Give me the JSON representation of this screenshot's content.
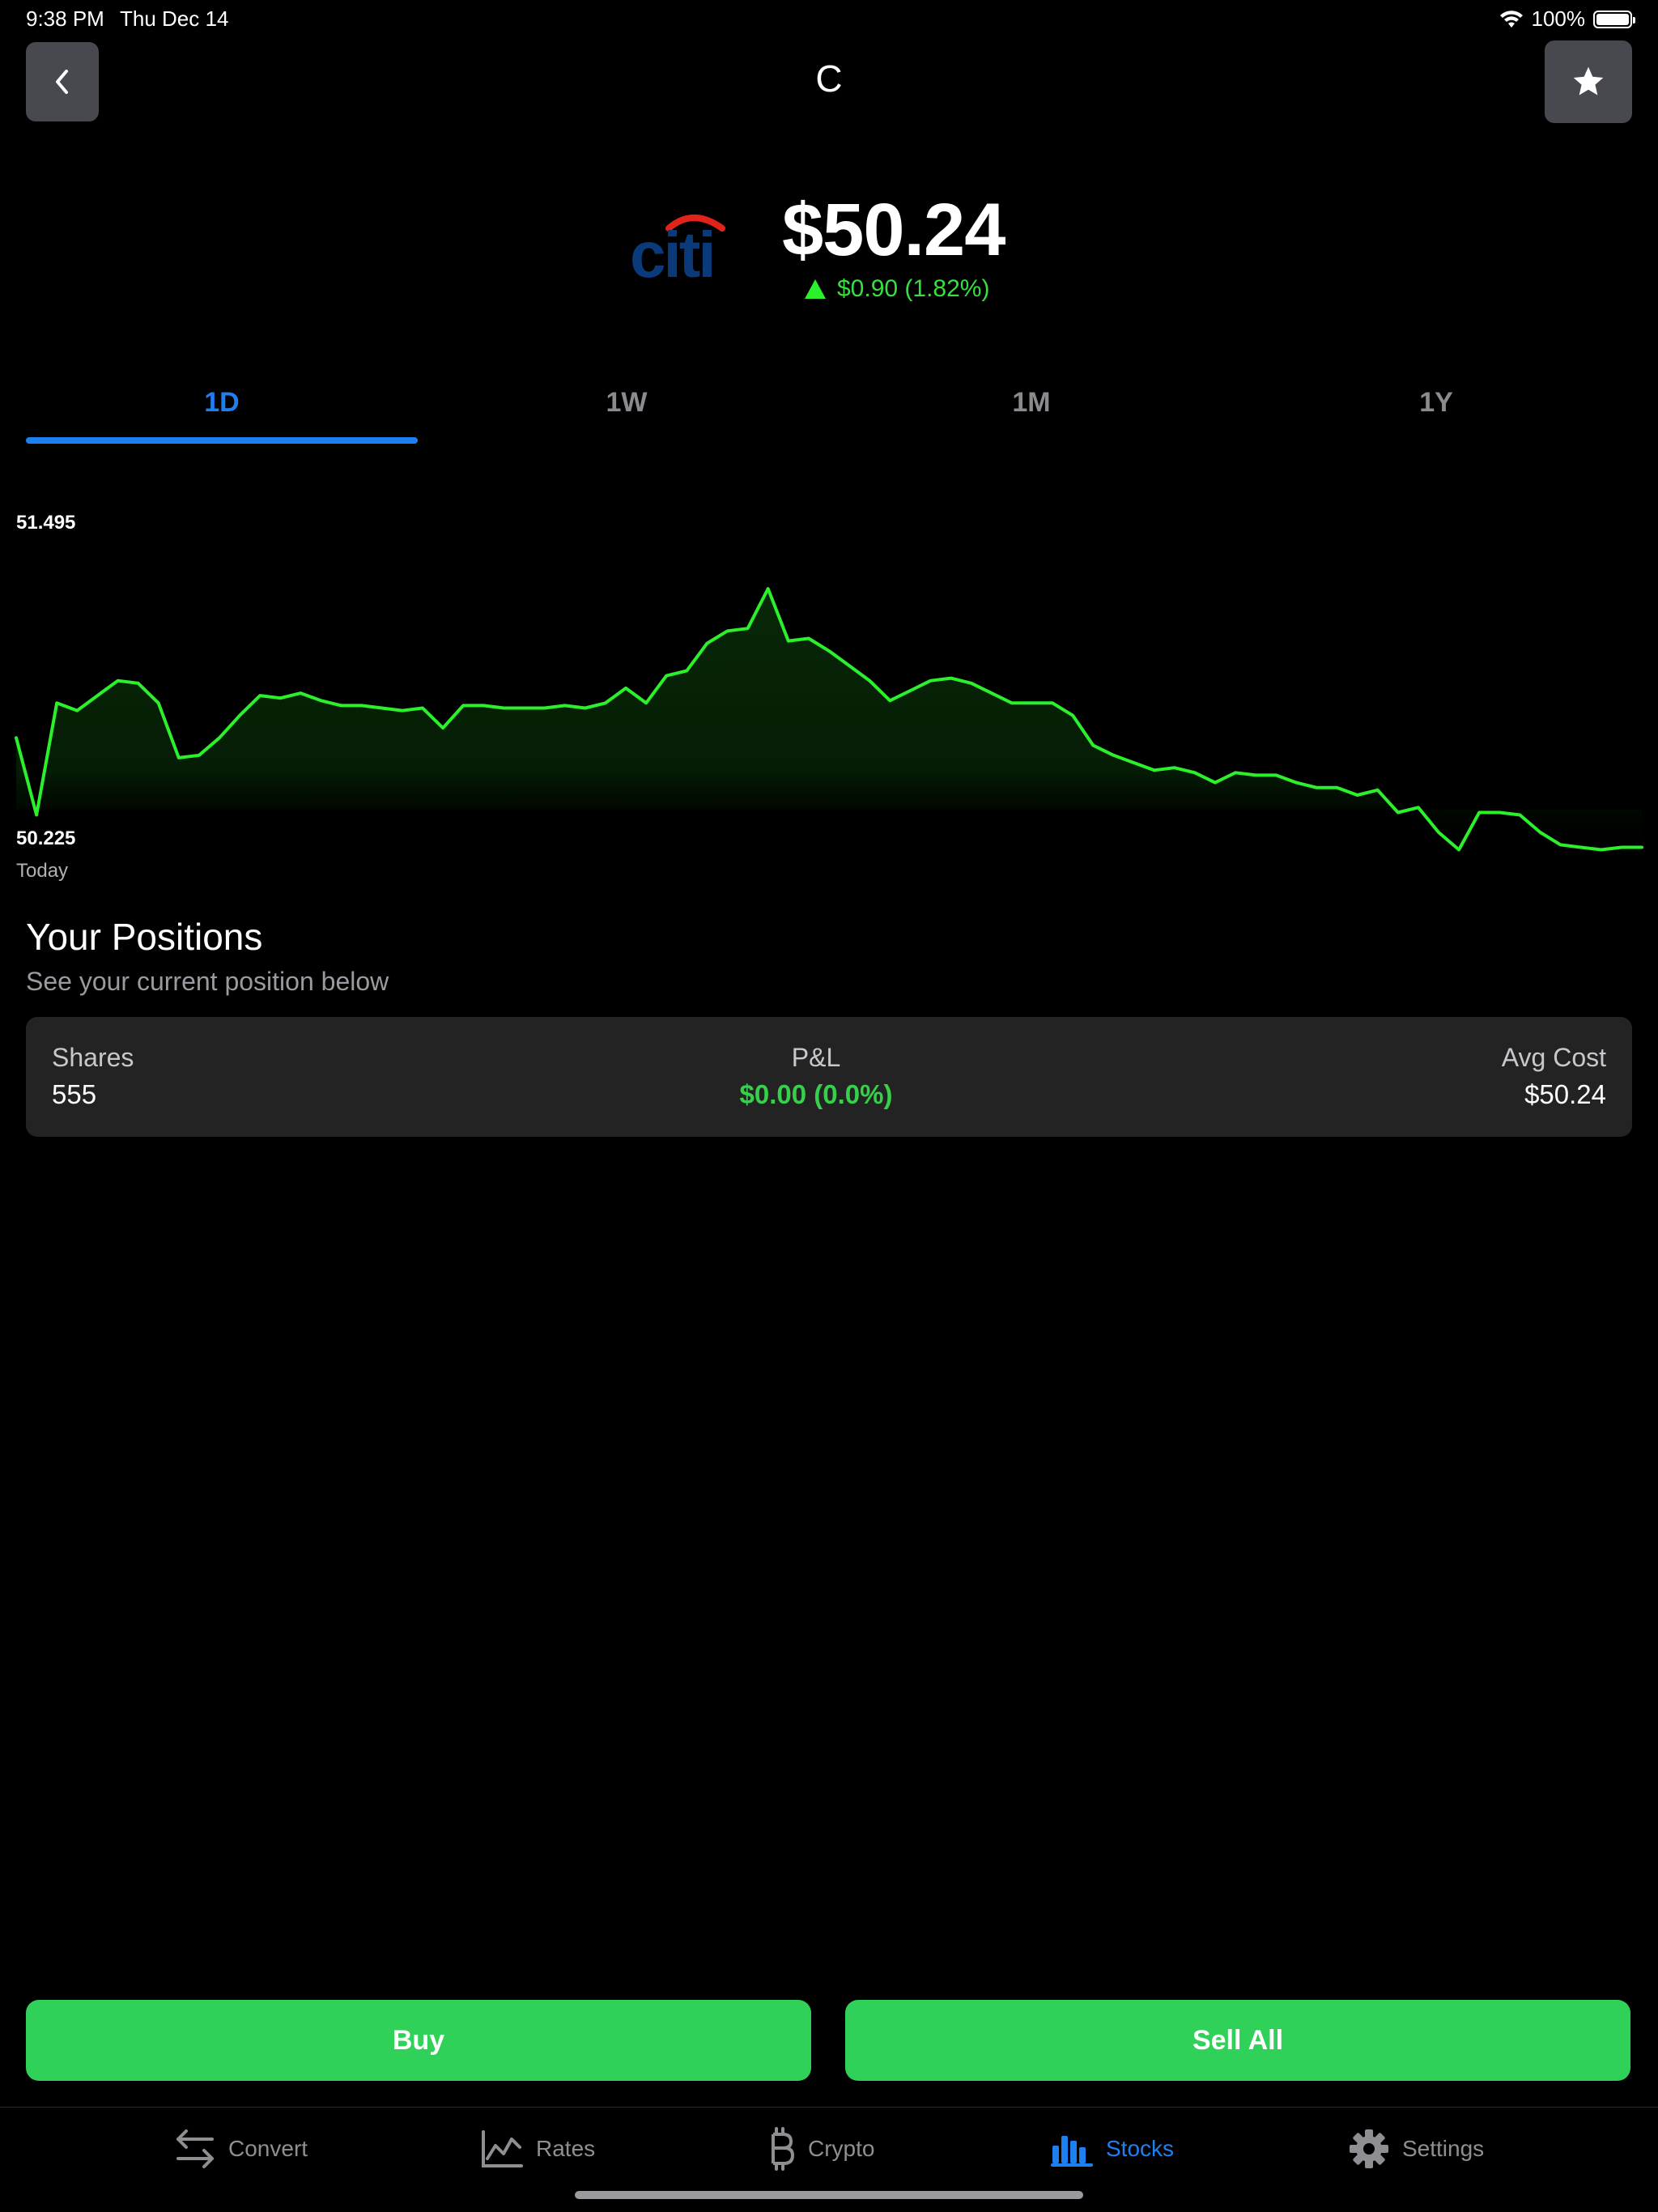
{
  "status_bar": {
    "time": "9:38 PM",
    "date": "Thu Dec 14",
    "battery": "100%"
  },
  "header": {
    "ticker": "C"
  },
  "quote": {
    "logo_text": "citi",
    "price": "$50.24",
    "change": "$0.90 (1.82%)",
    "direction": "up"
  },
  "range_tabs": [
    {
      "label": "1D",
      "active": true
    },
    {
      "label": "1W",
      "active": false
    },
    {
      "label": "1M",
      "active": false
    },
    {
      "label": "1Y",
      "active": false
    }
  ],
  "chart_data": {
    "type": "area",
    "y_max_label": "51.495",
    "y_min_label": "50.225",
    "x_label": "Today",
    "ylim": [
      50.225,
      51.495
    ],
    "line_color": "#2cf02c",
    "values": [
      50.53,
      50.22,
      50.67,
      50.64,
      50.7,
      50.76,
      50.75,
      50.67,
      50.45,
      50.46,
      50.53,
      50.62,
      50.7,
      50.69,
      50.71,
      50.68,
      50.66,
      50.66,
      50.65,
      50.64,
      50.65,
      50.57,
      50.66,
      50.66,
      50.65,
      50.65,
      50.65,
      50.66,
      50.65,
      50.67,
      50.73,
      50.67,
      50.78,
      50.8,
      50.91,
      50.96,
      50.97,
      51.13,
      50.92,
      50.93,
      50.88,
      50.82,
      50.76,
      50.68,
      50.72,
      50.76,
      50.77,
      50.75,
      50.71,
      50.67,
      50.67,
      50.67,
      50.62,
      50.5,
      50.46,
      50.43,
      50.4,
      50.41,
      50.39,
      50.35,
      50.39,
      50.38,
      50.38,
      50.35,
      50.33,
      50.33,
      50.3,
      50.32,
      50.23,
      50.25,
      50.15,
      50.08,
      50.23,
      50.23,
      50.22,
      50.15,
      50.1,
      50.09,
      50.08,
      50.09,
      50.09
    ]
  },
  "positions": {
    "title": "Your Positions",
    "subtitle": "See your current position below",
    "shares_label": "Shares",
    "shares_value": "555",
    "pnl_label": "P&L",
    "pnl_value": "$0.00 (0.0%)",
    "avg_cost_label": "Avg Cost",
    "avg_cost_value": "$50.24"
  },
  "actions": {
    "buy": "Buy",
    "sell_all": "Sell All"
  },
  "tab_bar": [
    {
      "label": "Convert",
      "icon": "convert-arrows-icon",
      "active": false
    },
    {
      "label": "Rates",
      "icon": "line-chart-icon",
      "active": false
    },
    {
      "label": "Crypto",
      "icon": "bitcoin-icon",
      "active": false
    },
    {
      "label": "Stocks",
      "icon": "bar-chart-icon",
      "active": true
    },
    {
      "label": "Settings",
      "icon": "gear-icon",
      "active": false
    }
  ],
  "colors": {
    "accent": "#1e80f0",
    "positive": "#30d158",
    "chart_line": "#2cf02c"
  }
}
